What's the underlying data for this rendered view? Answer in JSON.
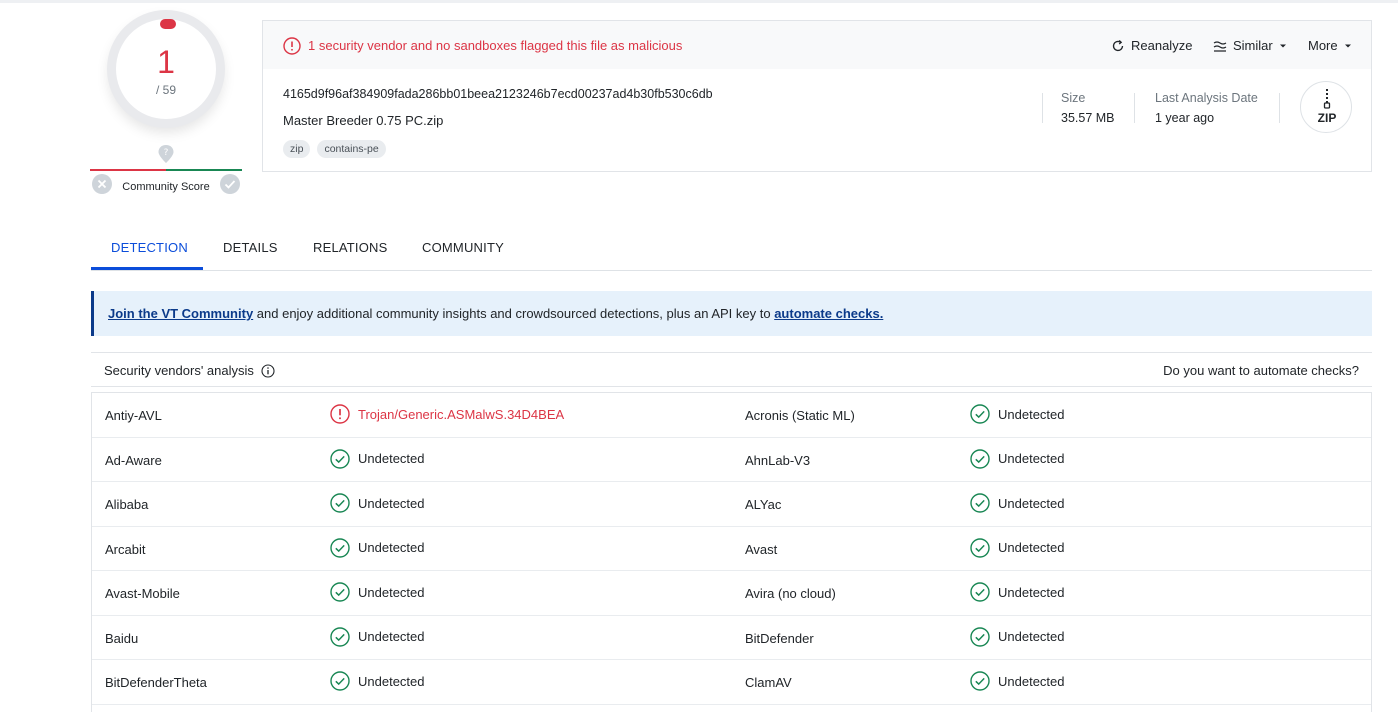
{
  "score": {
    "detections": "1",
    "total": "/ 59",
    "community_label": "Community Score"
  },
  "alert": {
    "message": "1 security vendor and no sandboxes flagged this file as malicious"
  },
  "actions": {
    "reanalyze": "Reanalyze",
    "similar": "Similar",
    "more": "More"
  },
  "file": {
    "hash": "4165d9f96af384909fada286bb01beea2123246b7ecd00237ad4b30fb530c6db",
    "name": "Master Breeder 0.75 PC.zip",
    "tags": [
      "zip",
      "contains-pe"
    ],
    "size_label": "Size",
    "size_value": "35.57 MB",
    "date_label": "Last Analysis Date",
    "date_value": "1 year ago",
    "type_badge": "ZIP"
  },
  "tabs": [
    {
      "label": "DETECTION",
      "active": true
    },
    {
      "label": "DETAILS",
      "active": false
    },
    {
      "label": "RELATIONS",
      "active": false
    },
    {
      "label": "COMMUNITY",
      "active": false
    }
  ],
  "banner": {
    "link1": "Join the VT Community",
    "middle": " and enjoy additional community insights and crowdsourced detections, plus an API key to ",
    "link2": "automate checks."
  },
  "section": {
    "title": "Security vendors' analysis",
    "right_link": "Do you want to automate checks?"
  },
  "vendors": [
    {
      "left_name": "Antiy-AVL",
      "left_result": "Trojan/Generic.ASMalwS.34D4BEA",
      "left_status": "malicious",
      "right_name": "Acronis (Static ML)",
      "right_result": "Undetected",
      "right_status": "undetected"
    },
    {
      "left_name": "Ad-Aware",
      "left_result": "Undetected",
      "left_status": "undetected",
      "right_name": "AhnLab-V3",
      "right_result": "Undetected",
      "right_status": "undetected"
    },
    {
      "left_name": "Alibaba",
      "left_result": "Undetected",
      "left_status": "undetected",
      "right_name": "ALYac",
      "right_result": "Undetected",
      "right_status": "undetected"
    },
    {
      "left_name": "Arcabit",
      "left_result": "Undetected",
      "left_status": "undetected",
      "right_name": "Avast",
      "right_result": "Undetected",
      "right_status": "undetected"
    },
    {
      "left_name": "Avast-Mobile",
      "left_result": "Undetected",
      "left_status": "undetected",
      "right_name": "Avira (no cloud)",
      "right_result": "Undetected",
      "right_status": "undetected"
    },
    {
      "left_name": "Baidu",
      "left_result": "Undetected",
      "left_status": "undetected",
      "right_name": "BitDefender",
      "right_result": "Undetected",
      "right_status": "undetected"
    },
    {
      "left_name": "BitDefenderTheta",
      "left_result": "Undetected",
      "left_status": "undetected",
      "right_name": "ClamAV",
      "right_result": "Undetected",
      "right_status": "undetected"
    }
  ],
  "colors": {
    "malicious": "#dc3545",
    "undetected": "#198754",
    "accent": "#0b4dda",
    "banner_bg": "#e6f1fb"
  }
}
